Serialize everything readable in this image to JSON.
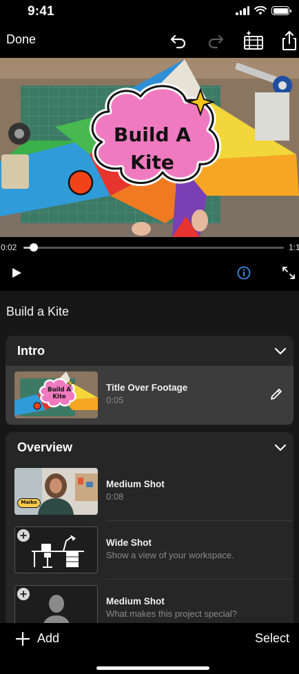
{
  "status_bar": {
    "time": "9:41"
  },
  "toolbar": {
    "done_label": "Done",
    "icons": [
      "undo-icon",
      "redo-icon",
      "magic-movie-icon",
      "share-icon"
    ]
  },
  "video": {
    "title_card": {
      "line1": "Build A",
      "line2": "Kite"
    }
  },
  "playback": {
    "current_time": "0:02",
    "end_time": "1:1",
    "progress": 0.04
  },
  "project": {
    "title": "Build a Kite",
    "sections": [
      {
        "label": "Intro",
        "shots": [
          {
            "name": "Title Over Footage",
            "detail": "0:05",
            "thumb_text": "Build A Kite",
            "selected": true
          }
        ]
      },
      {
        "label": "Overview",
        "shots": [
          {
            "name": "Medium Shot",
            "detail": "0:08",
            "thumb_text": "Maiko"
          },
          {
            "name": "Wide Shot",
            "detail": "Show a view of your workspace."
          },
          {
            "name": "Medium Shot",
            "detail": "What makes this project special?"
          }
        ]
      }
    ]
  },
  "bottom_bar": {
    "add_label": "Add",
    "select_label": "Select"
  },
  "colors": {
    "accent_blue": "#3d9bff",
    "card_pink": "#f07ac0",
    "background": "#171717",
    "section_bg": "#262626"
  }
}
